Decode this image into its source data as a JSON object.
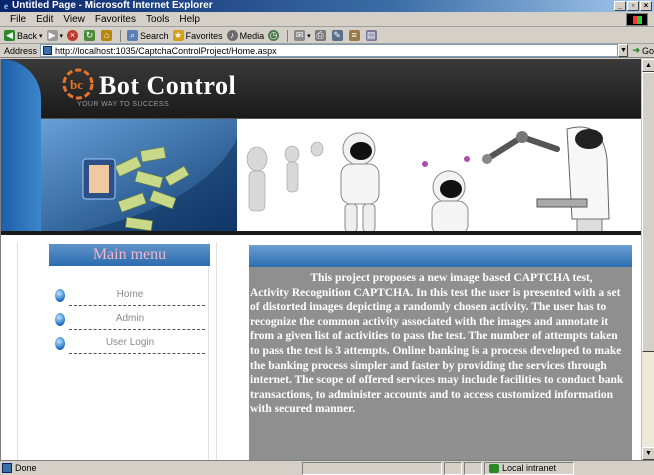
{
  "window": {
    "title": "Untitled Page - Microsoft Internet Explorer",
    "controls": [
      "_",
      "▫",
      "×"
    ]
  },
  "menubar": {
    "items": [
      {
        "label": "File"
      },
      {
        "label": "Edit"
      },
      {
        "label": "View"
      },
      {
        "label": "Favorites"
      },
      {
        "label": "Tools"
      },
      {
        "label": "Help"
      }
    ]
  },
  "toolbar": {
    "back_label": "Back",
    "search_label": "Search",
    "favorites_label": "Favorites",
    "media_label": "Media"
  },
  "addressbar": {
    "label": "Address",
    "url": "http://localhost:1035/CaptchaControlProject/Home.aspx",
    "go_label": "Go"
  },
  "banner": {
    "logo_mark": "bc",
    "brand_name": "Bot Control",
    "tagline": "YOUR WAY TO SUCCESS"
  },
  "sidebar": {
    "heading": "Main menu",
    "items": [
      {
        "label": "Home"
      },
      {
        "label": "Admin"
      },
      {
        "label": "User Login"
      }
    ]
  },
  "content": {
    "paragraph": "                     This project proposes a new image based CAPTCHA test, Activity Recognition CAPTCHA. In this test the user is presented with a set of distorted images depicting a randomly chosen activity. The user has to recognize the common activity associated with the images and annotate it from a given list of activities to pass the test. The number of attempts taken to pass the test is 3 attempts. Online banking is a process developed to make the banking process simpler and faster by providing the services through internet. The scope of offered services may include facilities to conduct bank transactions, to administer accounts and to access customized information with secured manner."
  },
  "statusbar": {
    "status": "Done",
    "zone": "Local intranet"
  }
}
